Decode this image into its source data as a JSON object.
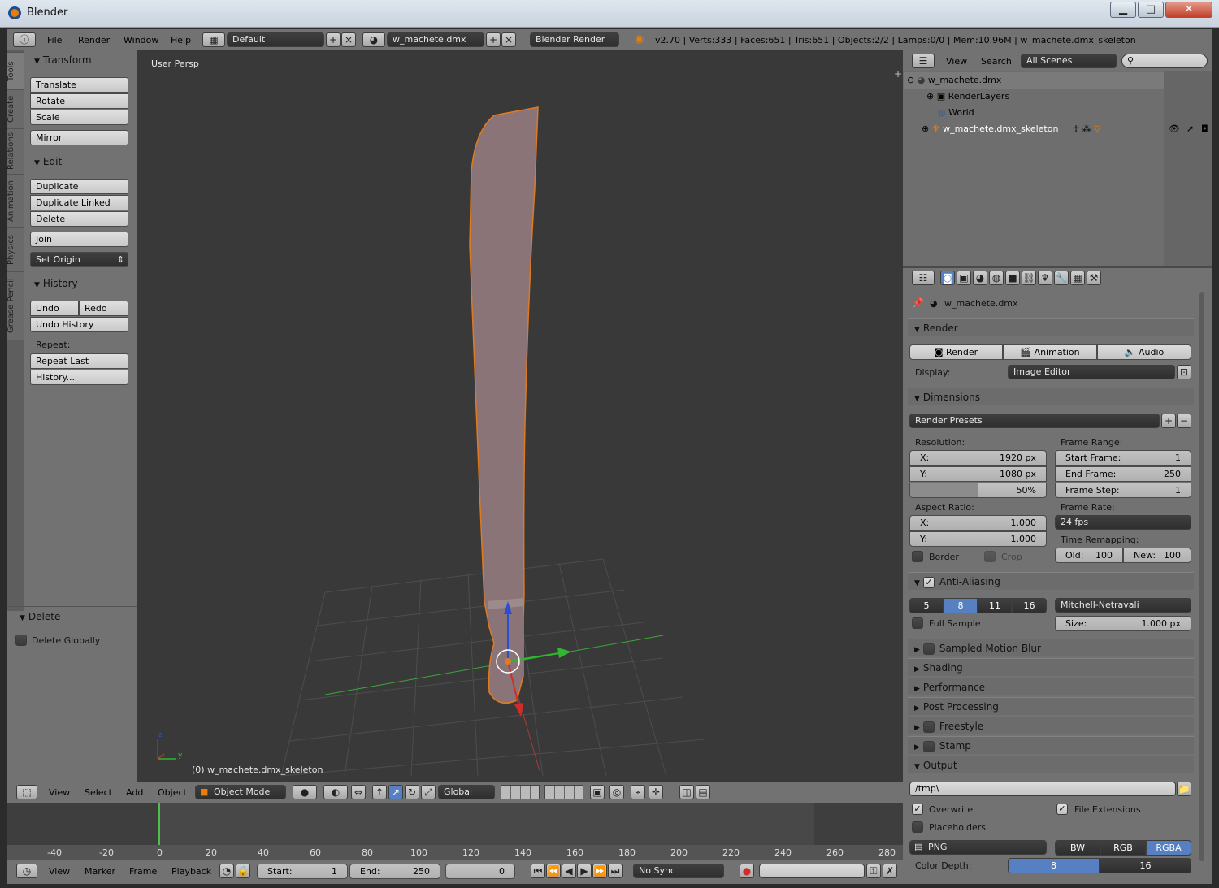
{
  "window": {
    "title": "Blender",
    "minimize": "▁",
    "maximize": "□",
    "close": "✕"
  },
  "menubar": {
    "info_icon": "ⓘ",
    "items": [
      "File",
      "Render",
      "Window",
      "Help"
    ],
    "layout_name": "Default",
    "scene_name": "w_machete.dmx",
    "engine": "Blender Render",
    "stats": "v2.70 | Verts:333 | Faces:651 | Tris:651 | Objects:2/2 | Lamps:0/0 | Mem:10.96M | w_machete.dmx_skeleton"
  },
  "toolshelf": {
    "tabs": [
      "Tools",
      "Create",
      "Relations",
      "Animation",
      "Physics",
      "Grease Pencil"
    ],
    "transform": {
      "title": "Transform",
      "buttons": [
        "Translate",
        "Rotate",
        "Scale",
        "Mirror"
      ]
    },
    "edit": {
      "title": "Edit",
      "buttons": [
        "Duplicate",
        "Duplicate Linked",
        "Delete",
        "Join"
      ],
      "set_origin": "Set Origin"
    },
    "history": {
      "title": "History",
      "undo": "Undo",
      "redo": "Redo",
      "undo_history": "Undo History",
      "repeat_label": "Repeat:",
      "repeat_last": "Repeat Last",
      "history_btn": "History..."
    },
    "operator": {
      "title": "Delete",
      "delete_globally": "Delete Globally"
    }
  },
  "viewport": {
    "title": "User Persp",
    "object_label": "(0) w_machete.dmx_skeleton",
    "axis_z": "z",
    "axis_y": "y"
  },
  "view3d_header": {
    "items": [
      "View",
      "Select",
      "Add",
      "Object"
    ],
    "mode": "Object Mode",
    "orientation": "Global"
  },
  "timeline": {
    "ticks": [
      "-40",
      "-20",
      "0",
      "20",
      "40",
      "60",
      "80",
      "100",
      "120",
      "140",
      "160",
      "180",
      "200",
      "220",
      "240",
      "260",
      "280"
    ],
    "current_frame_fraction": 0.0,
    "menu": [
      "View",
      "Marker",
      "Frame",
      "Playback"
    ],
    "start_label": "Start:",
    "start": "1",
    "end_label": "End:",
    "end": "250",
    "current": "0",
    "sync": "No Sync"
  },
  "outliner": {
    "menu": [
      "View",
      "Search"
    ],
    "scene_filter": "All Scenes",
    "rows": [
      {
        "label": "w_machete.dmx"
      },
      {
        "label": "RenderLayers"
      },
      {
        "label": "World"
      },
      {
        "label": "w_machete.dmx_skeleton"
      }
    ]
  },
  "properties": {
    "context_name": "w_machete.dmx",
    "render": {
      "title": "Render",
      "buttons": [
        "Render",
        "Animation",
        "Audio"
      ],
      "display_label": "Display:",
      "display": "Image Editor"
    },
    "dimensions": {
      "title": "Dimensions",
      "presets": "Render Presets",
      "resolution_label": "Resolution:",
      "res_x_label": "X:",
      "res_x": "1920 px",
      "res_y_label": "Y:",
      "res_y": "1080 px",
      "res_pct": "50%",
      "res_pct_fraction": 0.5,
      "frame_range_label": "Frame Range:",
      "start_label": "Start Frame:",
      "start": "1",
      "end_label": "End Frame:",
      "end": "250",
      "step_label": "Frame Step:",
      "step": "1",
      "aspect_label": "Aspect Ratio:",
      "asp_x_label": "X:",
      "asp_x": "1.000",
      "asp_y_label": "Y:",
      "asp_y": "1.000",
      "frame_rate_label": "Frame Rate:",
      "frame_rate": "24 fps",
      "time_remap_label": "Time Remapping:",
      "old_label": "Old:",
      "old": "100",
      "new_label": "New:",
      "new": "100",
      "border": "Border",
      "crop": "Crop"
    },
    "antialiasing": {
      "title": "Anti-Aliasing",
      "samples": [
        "5",
        "8",
        "11",
        "16"
      ],
      "selected": "8",
      "filter": "Mitchell-Netravali",
      "full_sample": "Full Sample",
      "size_label": "Size:",
      "size": "1.000 px"
    },
    "collapsed": [
      "Sampled Motion Blur",
      "Shading",
      "Performance",
      "Post Processing",
      "Freestyle",
      "Stamp"
    ],
    "output": {
      "title": "Output",
      "path": "/tmp\\",
      "overwrite": "Overwrite",
      "file_extensions": "File Extensions",
      "placeholders": "Placeholders",
      "format": "PNG",
      "color_modes": [
        "BW",
        "RGB",
        "RGBA"
      ],
      "color_mode_selected": "RGBA",
      "depth_label": "Color Depth:",
      "depths": [
        "8",
        "16"
      ],
      "depth_selected": "8"
    }
  },
  "colors": {
    "accent": "#5680c2",
    "selection_outline": "#e07a20",
    "mesh": "#8a7478",
    "x_axis": "#d32a2a",
    "y_axis": "#2fb82f",
    "z_axis": "#2a4fd3"
  }
}
